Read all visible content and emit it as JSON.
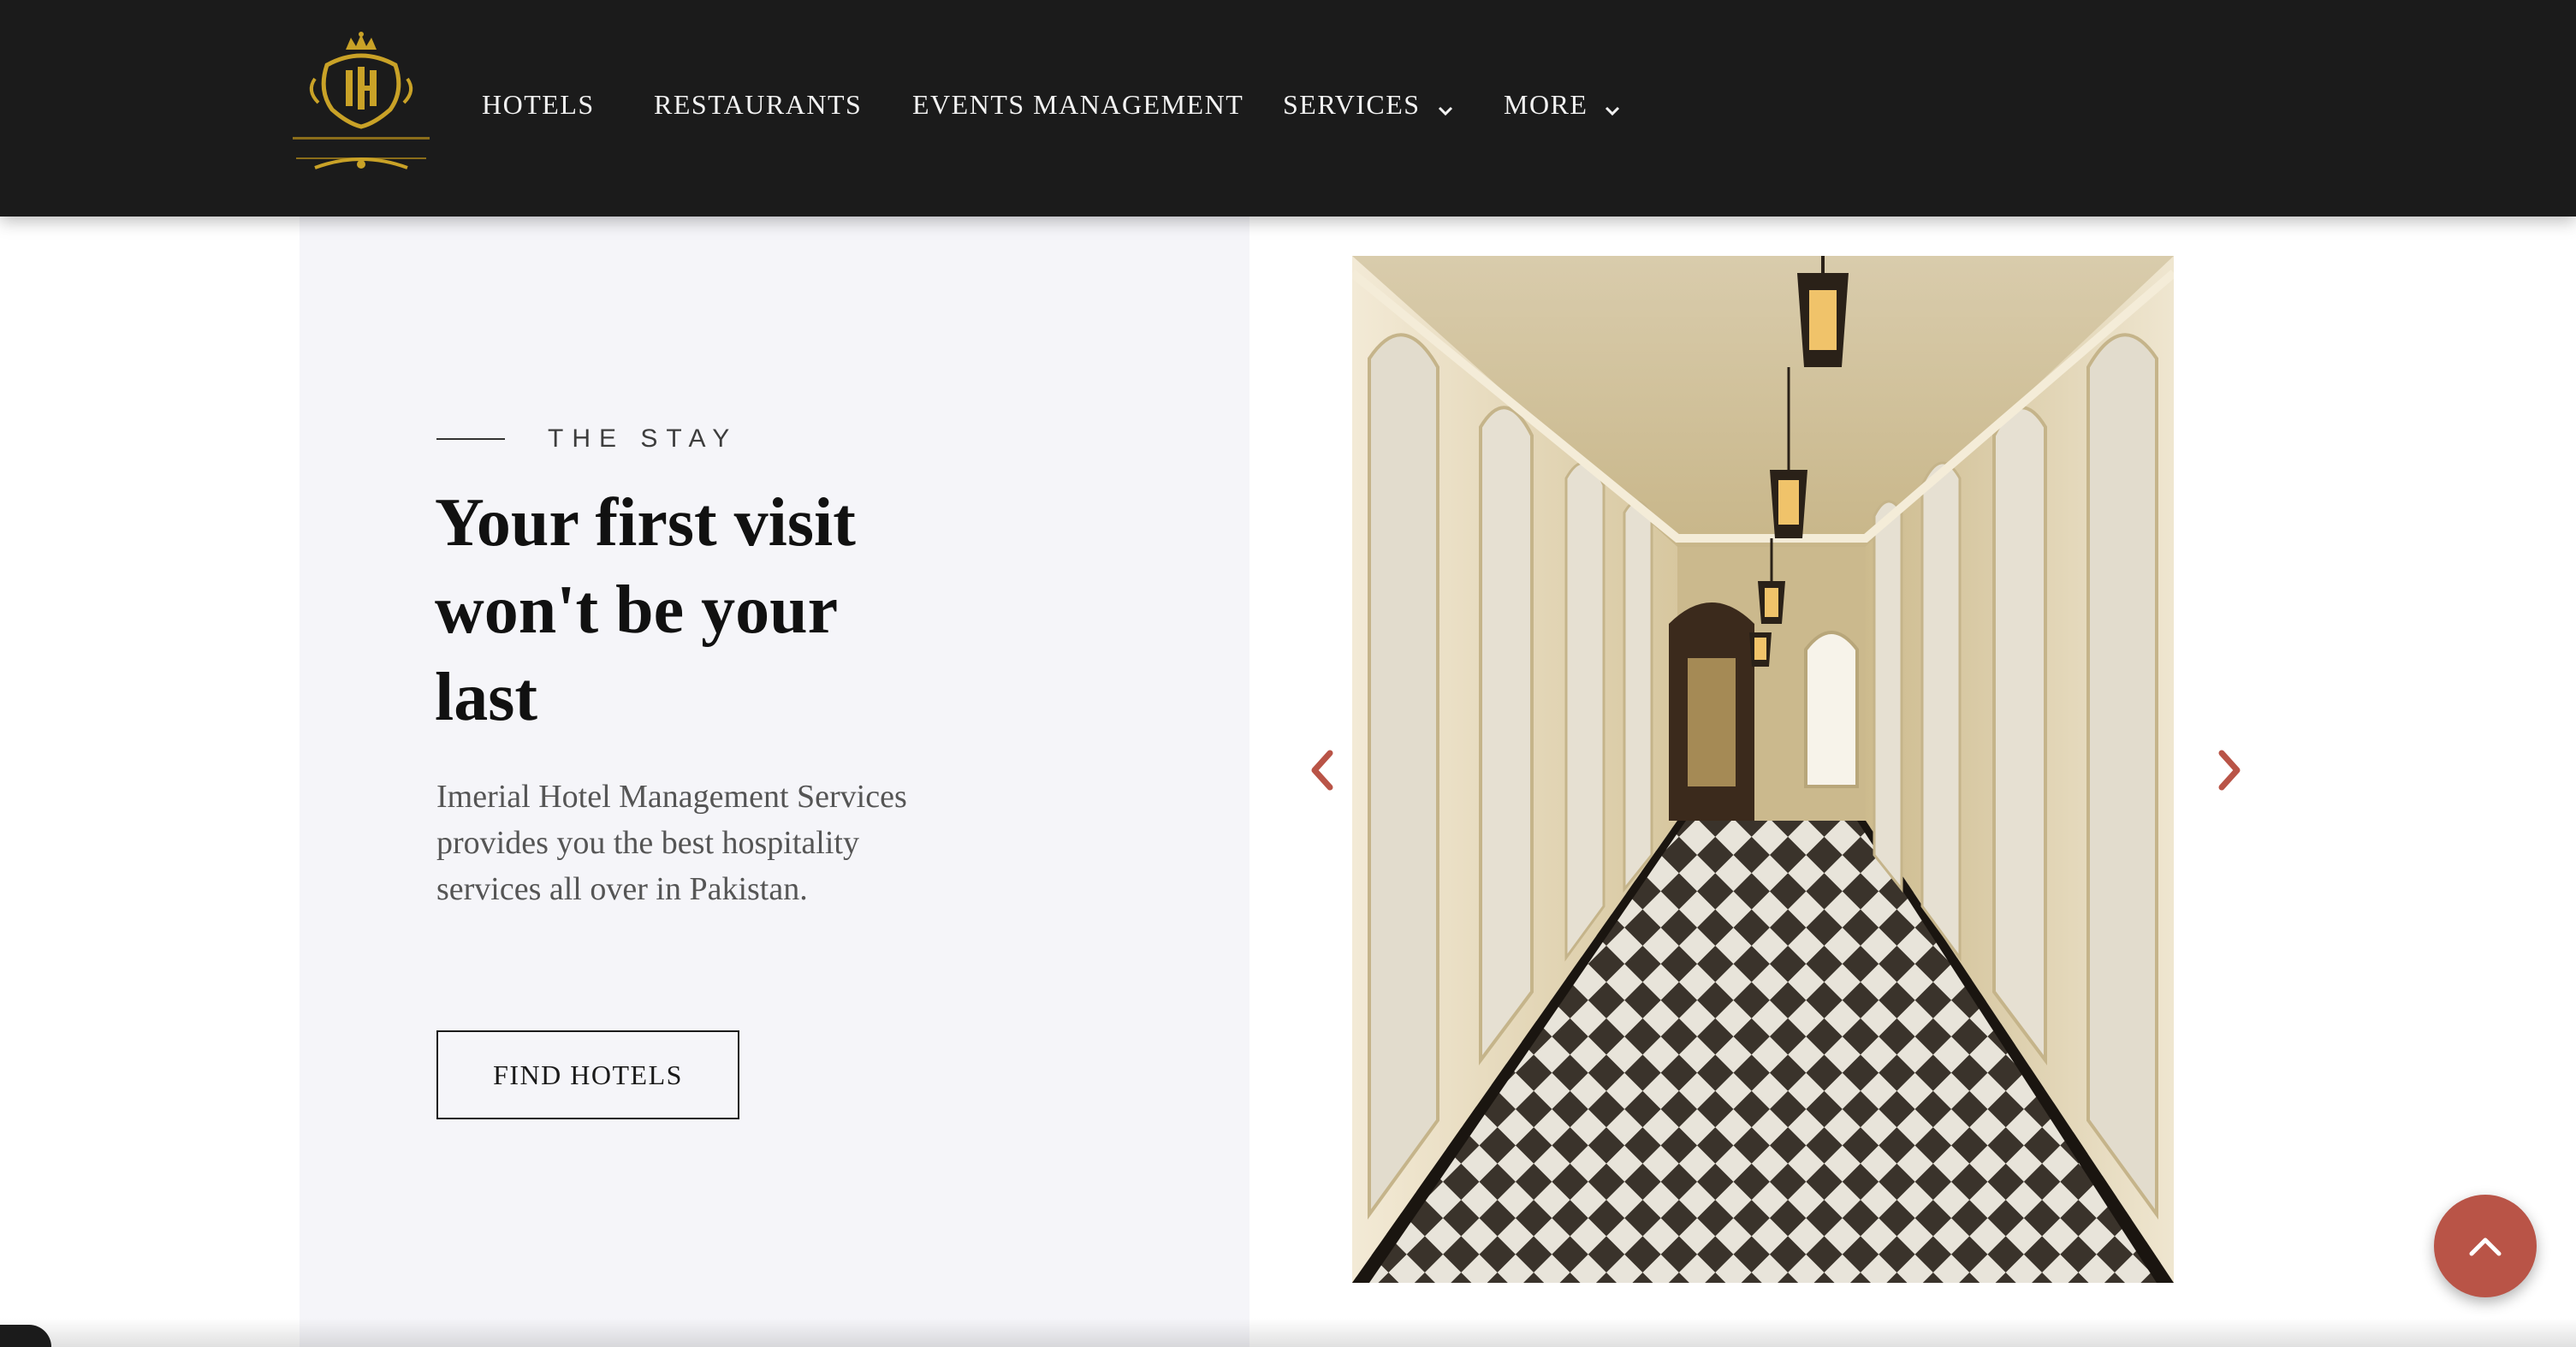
{
  "navbar": {
    "logo_text": "IMPERIAL HOTEL",
    "items": [
      {
        "label": "HOTELS",
        "has_dropdown": false
      },
      {
        "label": "RESTAURANTS",
        "has_dropdown": false
      },
      {
        "label": "EVENTS MANAGEMENT",
        "has_dropdown": false
      },
      {
        "label": "SERVICES",
        "has_dropdown": true
      },
      {
        "label": "MORE",
        "has_dropdown": true
      }
    ]
  },
  "hero": {
    "eyebrow": "THE STAY",
    "headline": "Your first visit won't be your last",
    "description": "Imerial Hotel Management Services provides you the best hospitality services all over in Pakistan.",
    "cta_label": "FIND HOTELS"
  },
  "carousel": {
    "image_icon": "corridor-photo",
    "prev_icon": "chevron-left-icon",
    "next_icon": "chevron-right-icon"
  },
  "scroll_top": {
    "icon": "chevron-up-icon"
  },
  "colors": {
    "nav_bg": "#1b1b1b",
    "panel_bg": "#f5f5f9",
    "accent": "#b95447",
    "gold": "#c9a227"
  }
}
